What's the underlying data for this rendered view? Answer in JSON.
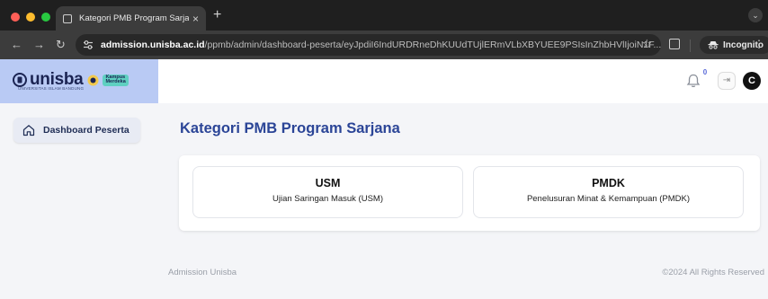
{
  "browser": {
    "tab": {
      "title": "Kategori PMB Program Sarjan"
    },
    "new_tab_symbol": "+",
    "url": {
      "host": "admission.unisba.ac.id",
      "path": "/ppmb/admin/dashboard-peserta/eyJpdiI6IndURDRneDhKUUdTUjlERmVLbXBYUEE9PSIsInZhbHVlIjoiN1F..."
    },
    "incognito_label": "Incognito",
    "colors": {
      "tabbar": "#1f1f1f",
      "toolbar": "#3c3c3c"
    }
  },
  "app": {
    "logo": {
      "wordmark": "unisba",
      "badge_line1": "Kampus",
      "badge_line2": "Merdeka",
      "tagline": "UNIVERSITAS ISLAM BANDUNG"
    },
    "header": {
      "notification_count": "0",
      "avatar_initial": "C",
      "icons": [
        "bell-icon",
        "logout-icon"
      ]
    },
    "sidebar": {
      "items": [
        {
          "label": "Dashboard Peserta",
          "icon": "home-icon",
          "active": true
        }
      ]
    },
    "main": {
      "title": "Kategori PMB Program Sarjana",
      "cards": [
        {
          "title": "USM",
          "subtitle": "Ujian Saringan Masuk (USM)"
        },
        {
          "title": "PMDK",
          "subtitle": "Penelusuran Minat & Kemampuan (PMDK)"
        }
      ]
    },
    "footer": {
      "left": "Admission Unisba",
      "right": "©2024 All Rights Reserved"
    },
    "colors": {
      "accent": "#2b4597",
      "logo_bg": "#b9caf4",
      "page_bg": "#f4f5f8"
    }
  }
}
